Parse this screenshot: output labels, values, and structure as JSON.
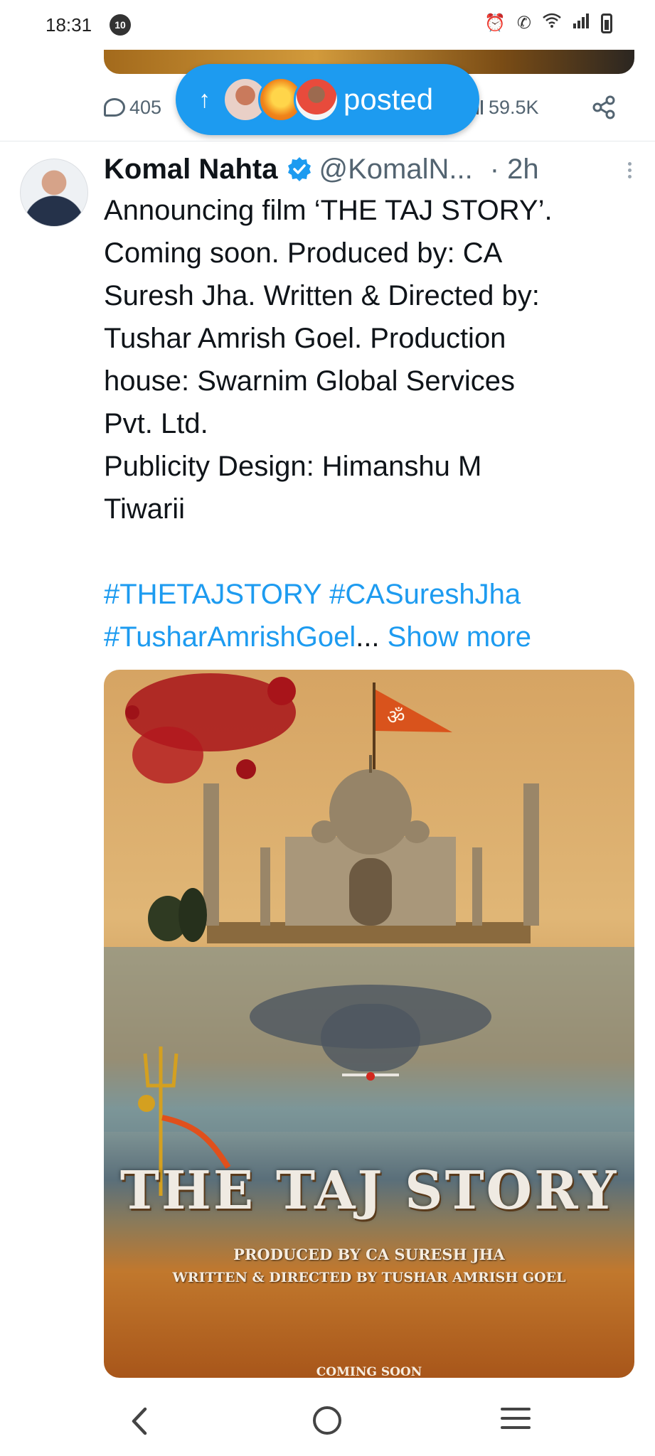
{
  "status_bar": {
    "time": "18:31",
    "notification_count": "10"
  },
  "previous_post": {
    "reply_count": "405",
    "view_count": "59.5K"
  },
  "new_posts_pill": {
    "label": "posted",
    "accent_color": "#1d9bf0"
  },
  "tweet": {
    "author_name": "Komal Nahta",
    "author_handle": "@KomalN...",
    "time_ago": "· 2h",
    "body_lines": [
      "Announcing film ‘THE TAJ STORY’.",
      "Coming soon. Produced by: CA",
      "Suresh Jha. Written & Directed by:",
      "Tushar Amrish Goel. Production",
      "house: Swarnim Global Services",
      "Pvt. Ltd.",
      "Publicity Design: Himanshu M",
      "Tiwarii"
    ],
    "hashtags_line1": "#THETAJSTORY #CASureshJha",
    "hashtags_line2": "#TusharAmrishGoel",
    "ellipsis": "...",
    "show_more": "Show more",
    "media": {
      "poster_flag_symbol": "ॐ",
      "poster_title": "THE TAJ STORY",
      "poster_produced_by": "PRODUCED BY CA SURESH JHA",
      "poster_written_by": "WRITTEN & DIRECTED BY TUSHAR AMRISH GOEL",
      "poster_footer": "COMING SOON"
    }
  },
  "nav_bar": {
    "back_icon": "chevron-left-icon",
    "home_icon": "circle-home-icon",
    "recents_icon": "three-lines-icon"
  }
}
